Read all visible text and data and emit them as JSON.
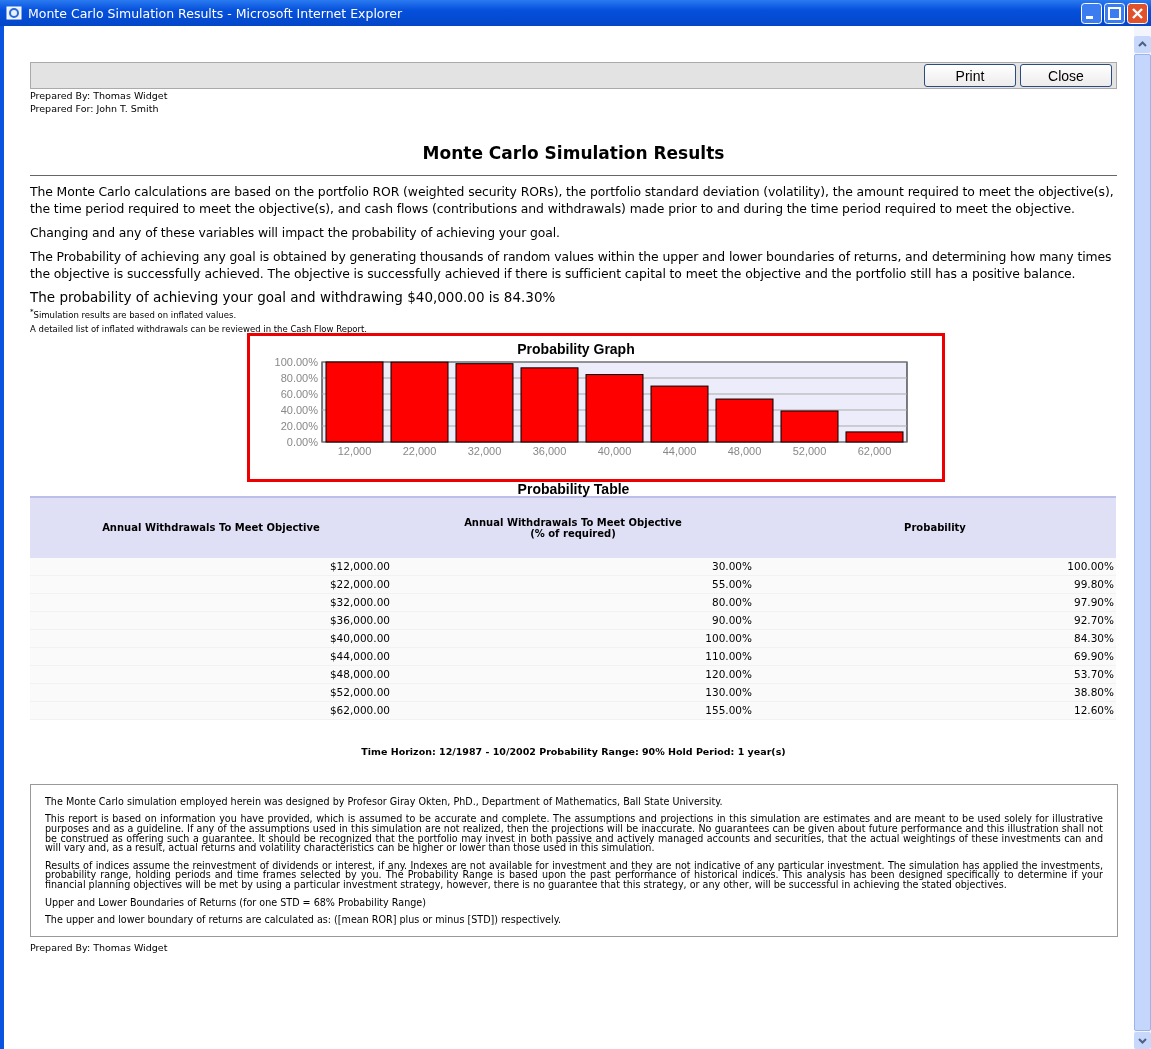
{
  "window": {
    "title": "Monte Carlo Simulation Results - Microsoft Internet Explorer"
  },
  "toolbar": {
    "buttons": [
      "Print",
      "Close"
    ]
  },
  "prepared": [
    "Prepared By: Thomas Widget",
    "Prepared For: John T. Smith"
  ],
  "heading": "Monte Carlo Simulation Results",
  "paragraphs": [
    "The Monte Carlo calculations are based on the portfolio ROR (weighted security RORs), the portfolio standard deviation (volatility), the amount required to meet the objective(s), the time period required to meet the objective(s), and cash flows (contributions and withdrawals) made prior to and during the time period required to meet the objective.",
    "Changing and any of these variables will impact the probability of achieving your goal.",
    "The Probability of achieving any goal is obtained by generating thousands of random values within the upper and lower boundaries of returns, and determining how many times the objective is successfully achieved. The objective is successfully achieved if there is sufficient capital to meet the objective and the portfolio still has a positive balance."
  ],
  "summary": "The probability of achieving your goal and withdrawing $40,000.00 is 84.30%",
  "notes": [
    "$^{*}$Simulation results are based on inflated values.",
    "A detailed list of inflated withdrawals can be reviewed in the Cash Flow Report."
  ],
  "graph": {
    "chart_data": {
      "type": "bar",
      "title": "Probability Graph",
      "categories": [
        "12,000",
        "22,000",
        "32,000",
        "36,000",
        "40,000",
        "44,000",
        "48,000",
        "52,000",
        "62,000"
      ],
      "grid": true,
      "series": [
        {
          "color": "#ff0000",
          "values": [
            100,
            99.8,
            97.9,
            92.7,
            84.3,
            69.9,
            53.7,
            38.8,
            12.6
          ]
        }
      ],
      "ylim": [
        0,
        100
      ],
      "yticks": [
        {
          "value": 0,
          "label": "0.00%"
        },
        {
          "value": 20,
          "label": "20.00%"
        },
        {
          "value": 40,
          "label": "40.00%"
        },
        {
          "value": 60,
          "label": "60.00%"
        },
        {
          "value": 80,
          "label": "80.00%"
        },
        {
          "value": 100,
          "label": "100.00%"
        }
      ]
    }
  },
  "table": {
    "title": "Probability Table",
    "columns": [
      {
        "label": "Annual Withdrawals To Meet Objective"
      },
      {
        "label": "Annual Withdrawals To Meet Objective",
        "sub": "(% of required)"
      },
      {
        "label": "Probability"
      }
    ],
    "rows": [
      [
        "$12,000.00",
        "30.00%",
        "100.00%"
      ],
      [
        "$22,000.00",
        "55.00%",
        "99.80%"
      ],
      [
        "$32,000.00",
        "80.00%",
        "97.90%"
      ],
      [
        "$36,000.00",
        "90.00%",
        "92.70%"
      ],
      [
        "$40,000.00",
        "100.00%",
        "84.30%"
      ],
      [
        "$44,000.00",
        "110.00%",
        "69.90%"
      ],
      [
        "$48,000.00",
        "120.00%",
        "53.70%"
      ],
      [
        "$52,000.00",
        "130.00%",
        "38.80%"
      ],
      [
        "$62,000.00",
        "155.00%",
        "12.60%"
      ]
    ]
  },
  "horizon": "Time Horizon: 12/1987 - 10/2002 Probability Range: 90% Hold Period: 1 year(s)",
  "disclaimer": [
    "The Monte Carlo simulation employed herein was designed by Profesor Giray Okten, PhD., Department of Mathematics, Ball State University.",
    "This report is based on information you have provided, which is assumed to be accurate and complete. The assumptions and projections in this simulation are estimates and are meant to be used solely for illustrative purposes and as a guideline. If any of the assumptions used in this simulation are not realized, then the projections will be inaccurate. No guarantees can be given about future performance and this illustration shall not be construed as offering such a guarantee. It should be recognized that the portfolio may invest in both passive and actively managed accounts and securities, that the actual weightings of these investments can and will vary and, as a result, actual returns and volatility characteristics can be higher or lower than those used in this simulation.",
    "Results of indices assume the reinvestment of dividends or interest, if any. Indexes are not available for investment and they are not indicative of any particular investment. The simulation has applied the investments, probability range, holding periods and time frames selected by you. The Probability Range is based upon the past performance of historical indices. This analysis has been designed specifically to determine if your financial planning objectives will be met by using a particular investment strategy, however, there is no guarantee that this strategy, or any other, will be successful in achieving the stated objectives.",
    "Upper and Lower Boundaries of Returns (for one STD = 68% Probability Range)",
    "The upper and lower boundary of returns are calculated as: ([mean ROR] plus or minus [STD]) respectively."
  ],
  "footer": "Prepared By: Thomas Widget"
}
